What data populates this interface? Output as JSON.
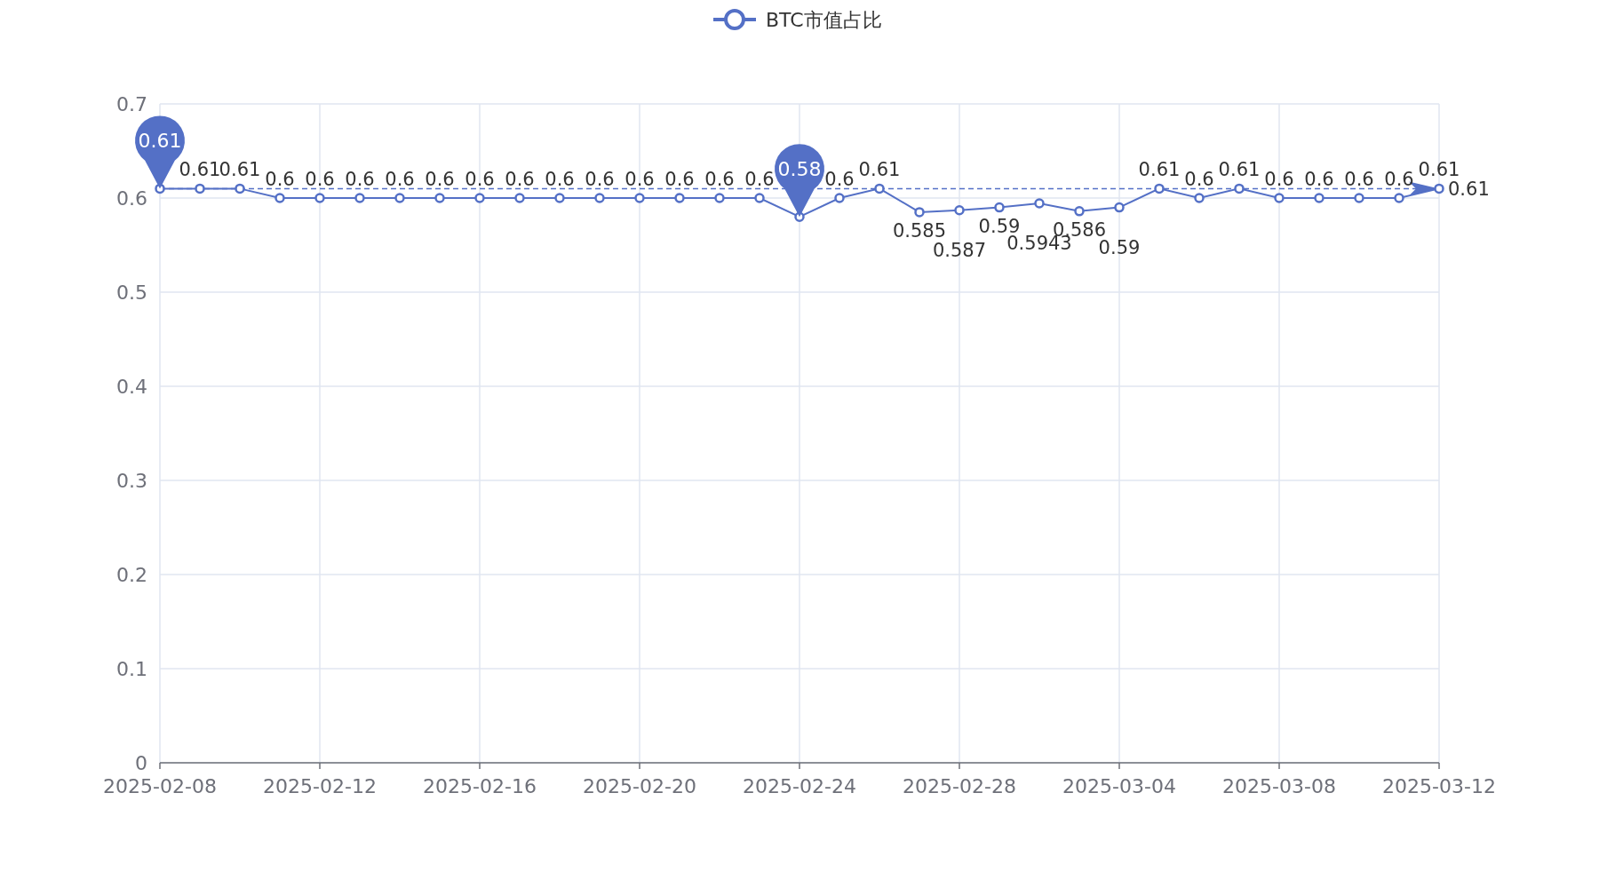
{
  "chart": {
    "chart_data": {
      "type": "line",
      "categories": [
        "2025-02-08",
        null,
        null,
        null,
        "2025-02-12",
        null,
        null,
        null,
        "2025-02-16",
        null,
        null,
        null,
        "2025-02-20",
        null,
        null,
        null,
        "2025-02-24",
        null,
        null,
        null,
        "2025-02-28",
        null,
        null,
        null,
        "2025-03-04",
        null,
        null,
        null,
        "2025-03-08",
        null,
        null,
        null,
        "2025-03-12"
      ],
      "series": [
        {
          "name": "BTC市值占比",
          "color": "#5470c6",
          "marker": "circle",
          "values": [
            0.61,
            0.61,
            0.61,
            0.6,
            0.6,
            0.6,
            0.6,
            0.6,
            0.6,
            0.6,
            0.6,
            0.6,
            0.6,
            0.6,
            0.6,
            0.6,
            0.58,
            0.6,
            0.61,
            0.585,
            0.587,
            0.59,
            0.5943,
            0.586,
            0.59,
            0.61,
            0.6,
            0.61,
            0.6,
            0.6,
            0.6,
            0.6,
            0.61
          ]
        }
      ],
      "ylim": [
        0,
        0.7
      ],
      "yticks": [
        0,
        0.1,
        0.2,
        0.3,
        0.4,
        0.5,
        0.6,
        0.7
      ],
      "grid": true,
      "data_labels": true,
      "annotations": [
        "0.61",
        "0.58"
      ],
      "ref_lines": [
        {
          "axis": "y",
          "value": 0.61,
          "label": "0.61"
        }
      ]
    }
  }
}
